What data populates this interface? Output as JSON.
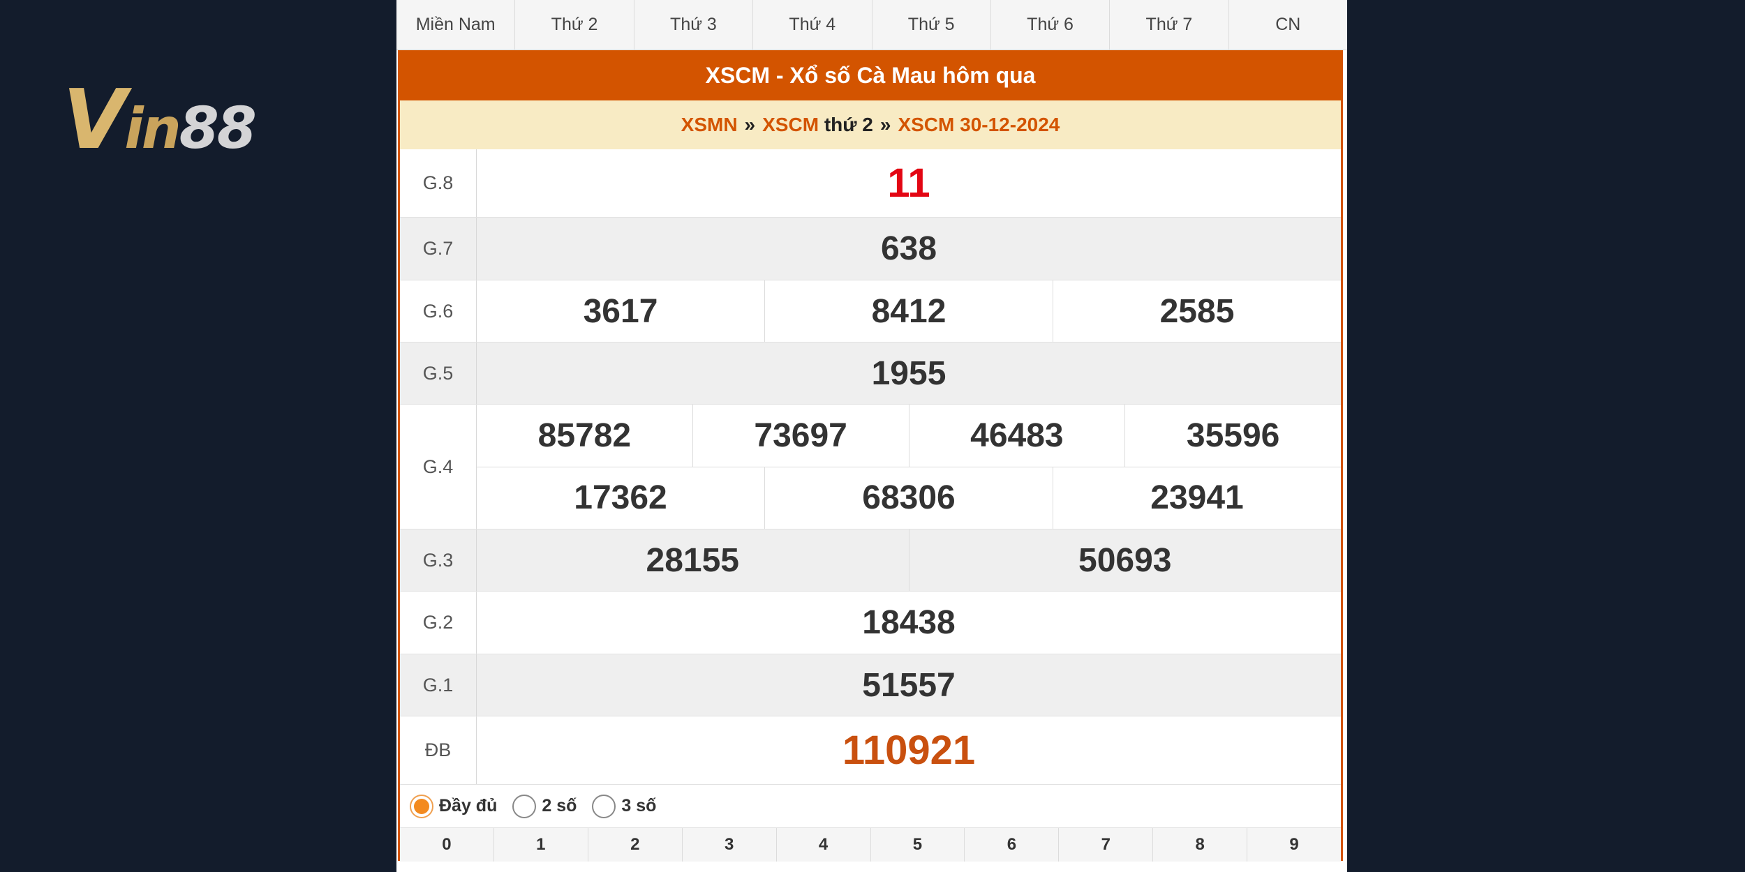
{
  "logo": {
    "alt": "Vin88",
    "part_v": "V",
    "part_in": "in",
    "part_88": "88",
    "colors": {
      "gold": "#d9b66e",
      "silver": "#d4d4d6"
    }
  },
  "tabs": [
    "Miền Nam",
    "Thứ 2",
    "Thứ 3",
    "Thứ 4",
    "Thứ 5",
    "Thứ 6",
    "Thứ 7",
    "CN"
  ],
  "title": "XSCM - Xổ số Cà Mau hôm qua",
  "breadcrumb": {
    "link1": "XSMN",
    "sep1": "»",
    "link2": "XSCM",
    "day": "thứ 2",
    "sep2": "»",
    "link3": "XSCM 30-12-2024"
  },
  "prizes": [
    {
      "label": "G.8",
      "numbers": [
        "11"
      ]
    },
    {
      "label": "G.7",
      "numbers": [
        "638"
      ]
    },
    {
      "label": "G.6",
      "numbers": [
        "3617",
        "8412",
        "2585"
      ]
    },
    {
      "label": "G.5",
      "numbers": [
        "1955"
      ]
    },
    {
      "label": "G.4",
      "numbers": [
        "85782",
        "73697",
        "46483",
        "35596",
        "17362",
        "68306",
        "23941"
      ]
    },
    {
      "label": "G.3",
      "numbers": [
        "28155",
        "50693"
      ]
    },
    {
      "label": "G.2",
      "numbers": [
        "18438"
      ]
    },
    {
      "label": "G.1",
      "numbers": [
        "51557"
      ]
    },
    {
      "label": "ĐB",
      "numbers": [
        "110921"
      ]
    }
  ],
  "options": [
    {
      "label": "Đầy đủ",
      "checked": true
    },
    {
      "label": "2 số",
      "checked": false
    },
    {
      "label": "3 số",
      "checked": false
    }
  ],
  "digits": [
    "0",
    "1",
    "2",
    "3",
    "4",
    "5",
    "6",
    "7",
    "8",
    "9"
  ],
  "colors": {
    "accent": "#d35400",
    "breadcrumb_bg": "#f8ebc4",
    "special_prize": "#c9500f",
    "g8_prize": "#e30613"
  }
}
